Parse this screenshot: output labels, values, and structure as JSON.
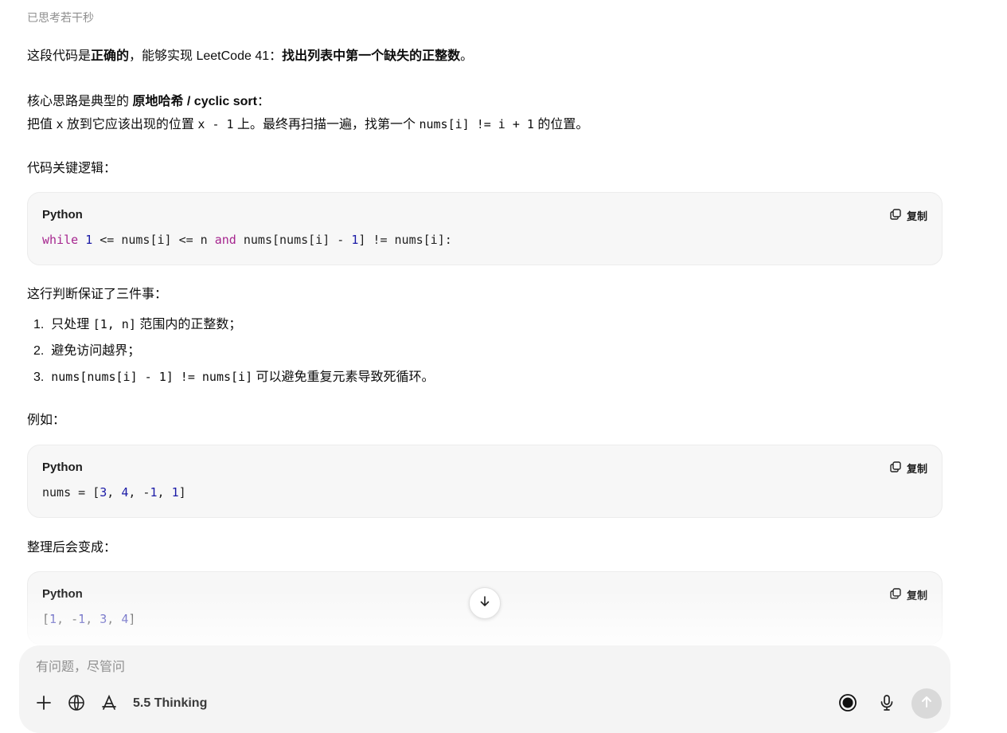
{
  "thinking_label": "已思考若干秒",
  "p1": {
    "a": "这段代码是",
    "b": "正确的",
    "c": "，能够实现 LeetCode 41：",
    "d": "找出列表中第一个缺失的正整数",
    "e": "。"
  },
  "p2": {
    "line1_a": "核心思路是典型的 ",
    "line1_b": "原地哈希 / cyclic sort",
    "line1_c": "：",
    "line2_a": "把值 ",
    "line2_code1": "x",
    "line2_b": " 放到它应该出现的位置 ",
    "line2_code2": "x - 1",
    "line2_c": " 上。最终再扫描一遍，找第一个 ",
    "line2_code3": "nums[i] != i + 1",
    "line2_d": " 的位置。"
  },
  "p3": "代码关键逻辑：",
  "code1": {
    "lang": "Python",
    "copy_label": "复制",
    "tokens": [
      {
        "t": "while",
        "c": "kw"
      },
      {
        "t": " "
      },
      {
        "t": "1",
        "c": "num"
      },
      {
        "t": " <= nums[i] <= n "
      },
      {
        "t": "and",
        "c": "kw"
      },
      {
        "t": " nums[nums[i] - "
      },
      {
        "t": "1",
        "c": "num"
      },
      {
        "t": "] != nums[i]:"
      }
    ]
  },
  "p4": "这行判断保证了三件事：",
  "list": [
    {
      "n": "1.",
      "a": "只处理 ",
      "code": "[1, n]",
      "b": " 范围内的正整数；"
    },
    {
      "n": "2.",
      "a": "避免访问越界；",
      "code": "",
      "b": ""
    },
    {
      "n": "3.",
      "a": "",
      "code": "nums[nums[i] - 1] != nums[i]",
      "b": " 可以避免重复元素导致死循环。"
    }
  ],
  "p5": "例如：",
  "code2": {
    "lang": "Python",
    "copy_label": "复制",
    "tokens": [
      {
        "t": "nums = ["
      },
      {
        "t": "3",
        "c": "num"
      },
      {
        "t": ", "
      },
      {
        "t": "4",
        "c": "num"
      },
      {
        "t": ", -"
      },
      {
        "t": "1",
        "c": "num"
      },
      {
        "t": ", "
      },
      {
        "t": "1",
        "c": "num"
      },
      {
        "t": "]"
      }
    ]
  },
  "p6": "整理后会变成：",
  "code3": {
    "lang": "Python",
    "copy_label": "复制",
    "tokens": [
      {
        "t": "["
      },
      {
        "t": "1",
        "c": "num"
      },
      {
        "t": ", -"
      },
      {
        "t": "1",
        "c": "num"
      },
      {
        "t": ", "
      },
      {
        "t": "3",
        "c": "num"
      },
      {
        "t": ", "
      },
      {
        "t": "4",
        "c": "num"
      },
      {
        "t": "]"
      }
    ]
  },
  "composer": {
    "placeholder": "有问题，尽管问",
    "model_label": "5.5 Thinking"
  },
  "icons": [
    "copy-icon",
    "arrow-down-icon",
    "plus-icon",
    "globe-icon",
    "tools-icon",
    "voice-mode-icon",
    "mic-icon",
    "send-arrow-icon"
  ]
}
